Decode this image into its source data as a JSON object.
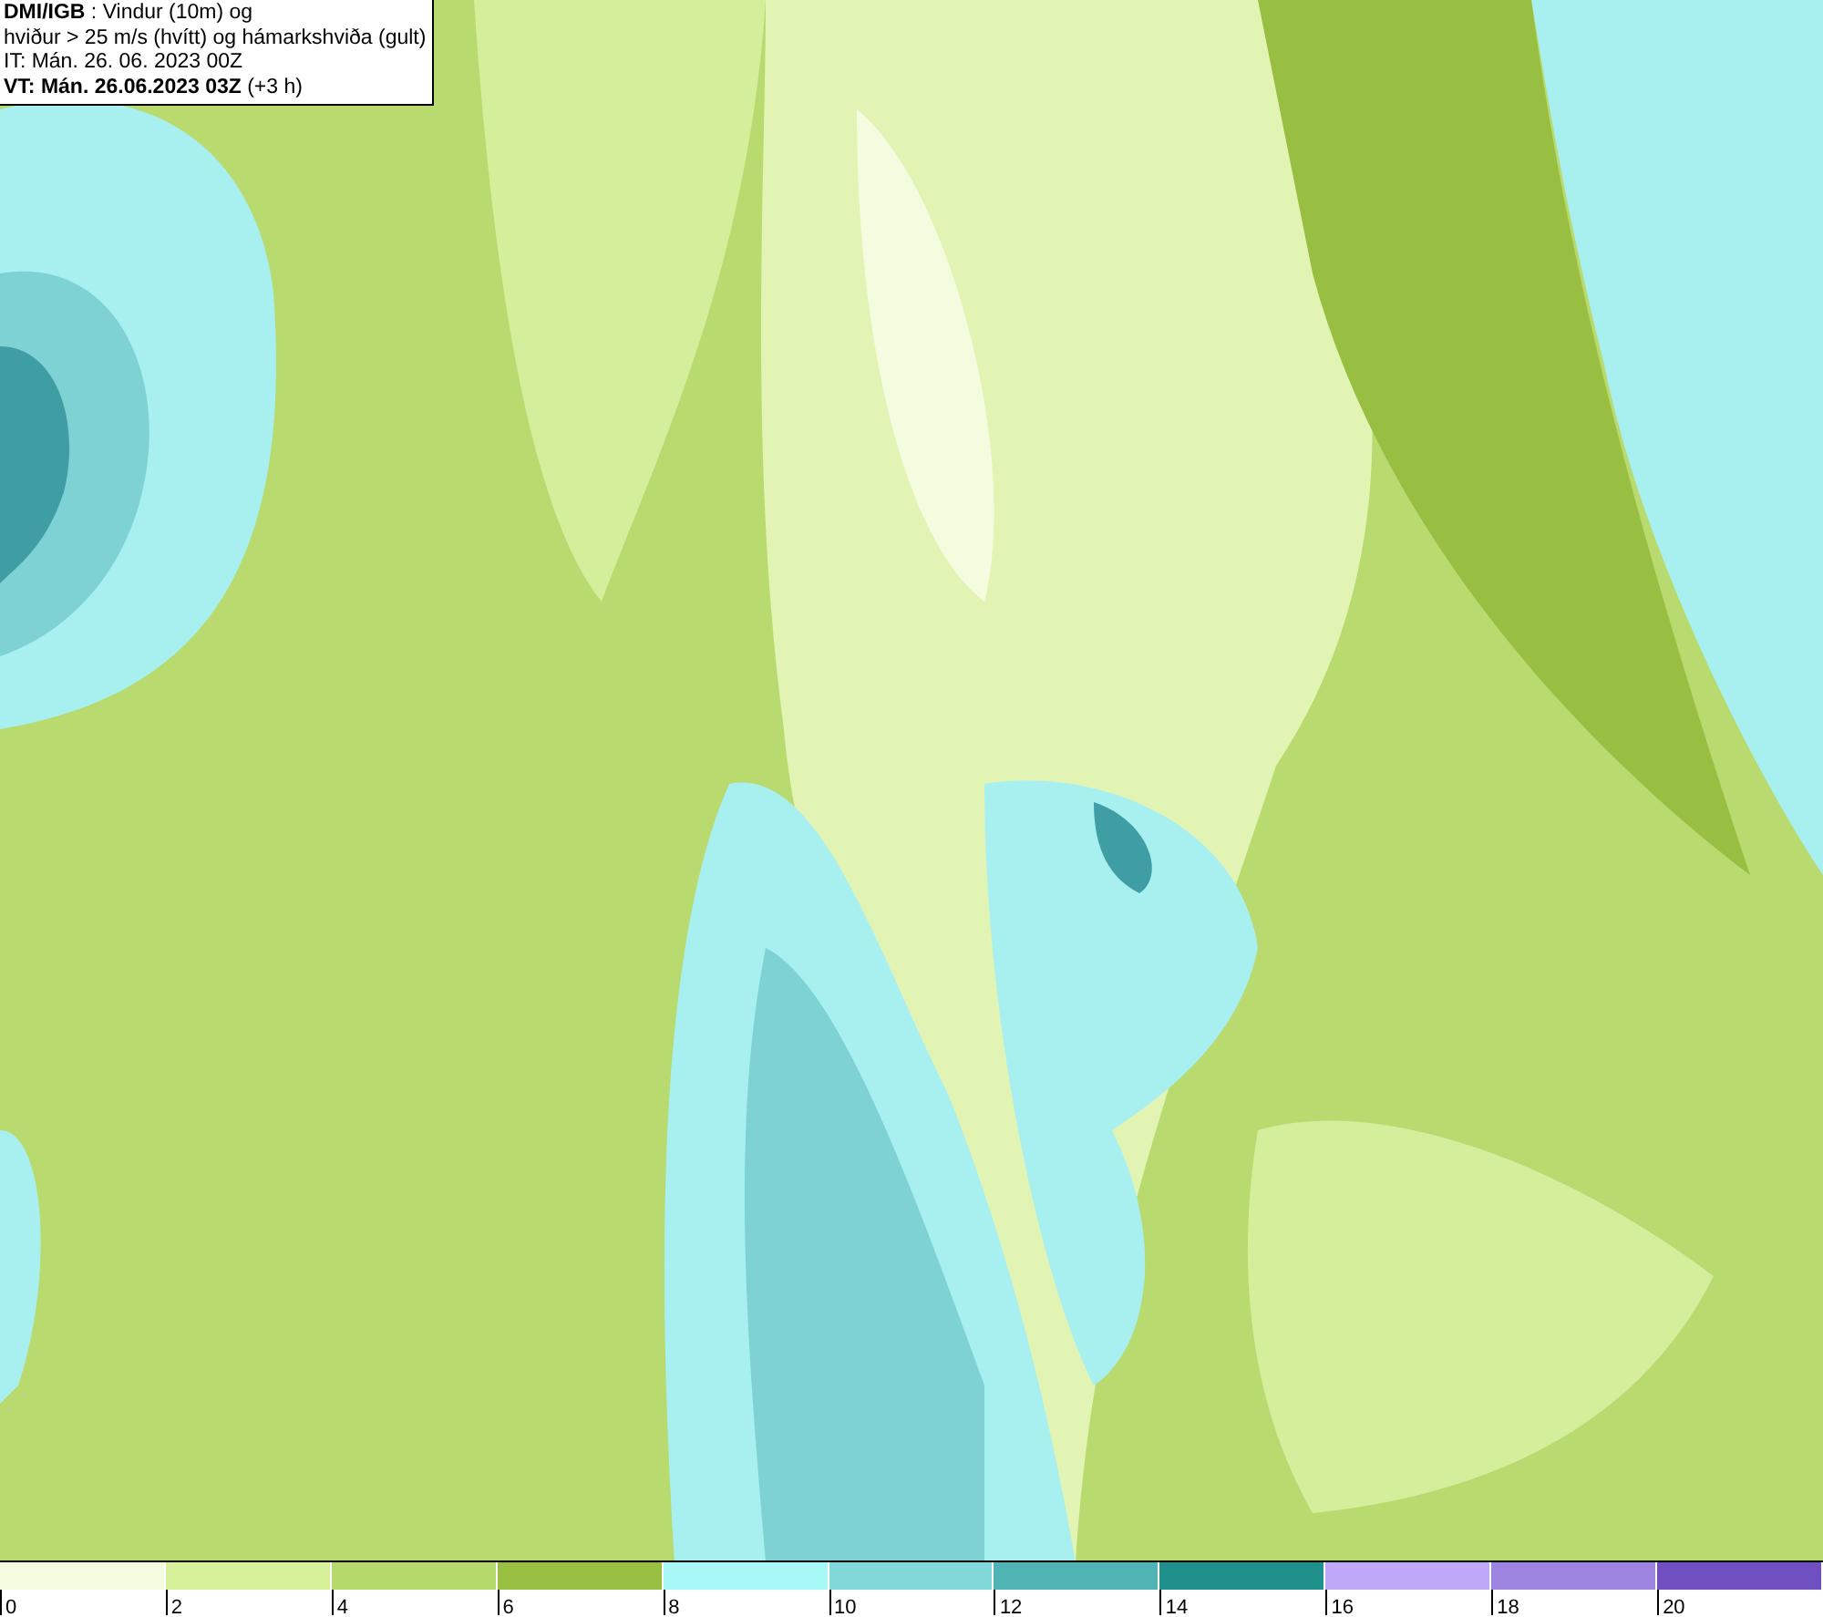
{
  "header": {
    "lines": [
      "**DMI/IGB** : Vindur (10m) og",
      "hviður > 25 m/s (hvítt) og hámarkshviða (gult)",
      "IT: Mán. 26. 06. 2023 00Z",
      "**VT: Mán. 26.06.2023 03Z** (+3 h)"
    ]
  },
  "legend": {
    "bins": [
      {
        "color": "#f4fce0"
      },
      {
        "color": "#d6f09a"
      },
      {
        "color": "#b6d96c"
      },
      {
        "color": "#98bf42"
      },
      {
        "color": "#a8f8f8"
      },
      {
        "color": "#80d8d8"
      },
      {
        "color": "#50b4b4"
      },
      {
        "color": "#20908c"
      },
      {
        "color": "#c0a8f8"
      },
      {
        "color": "#9c84e0"
      },
      {
        "color": "#7050c0"
      }
    ],
    "ticks": [
      "0",
      "2",
      "4",
      "6",
      "8",
      "10",
      "12",
      "14",
      "16",
      "18",
      "20"
    ]
  }
}
